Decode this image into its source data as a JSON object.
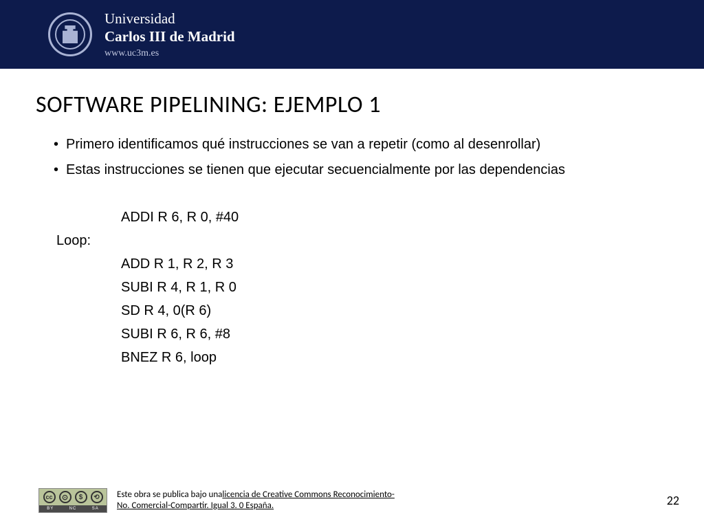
{
  "header": {
    "uni_line1": "Universidad",
    "uni_line2": "Carlos III de Madrid",
    "url": "www.uc3m.es"
  },
  "title": "SOFTWARE PIPELINING: EJEMPLO 1",
  "bullets": [
    "Primero identificamos qué instrucciones se van a repetir (como al desenrollar)",
    "Estas instrucciones se tienen que ejecutar secuencialmente por las dependencias"
  ],
  "code": {
    "pre": "ADDI R 6, R 0, #40",
    "label": "Loop:",
    "body": [
      "ADD R 1, R 2, R 3",
      "SUBI R 4, R 1, R 0",
      "SD R 4, 0(R 6)",
      "SUBI R 6, R 6, #8",
      "BNEZ R 6, loop"
    ]
  },
  "footer": {
    "license_prefix": "Este obra se publica bajo una",
    "license_link1": "licencia de Creative Commons Reconocimiento-",
    "license_link2": "No. Comercial-Compartir. Igual 3. 0 España.",
    "cc_labels": [
      "BY",
      "NC",
      "SA"
    ],
    "page": "22"
  }
}
